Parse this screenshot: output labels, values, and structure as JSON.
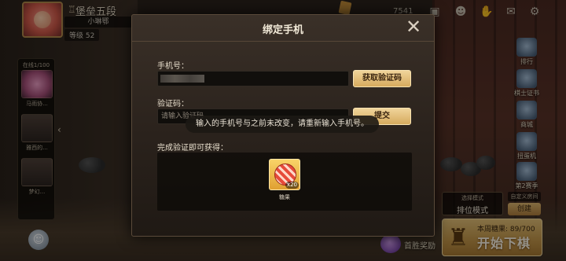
{
  "player": {
    "rank": "堡垒五段",
    "name": "小琳鄂",
    "level": "等级 52"
  },
  "friends": {
    "count": "在线1/100",
    "items": [
      {
        "name": "马雨协..."
      },
      {
        "name": "雅西的..."
      },
      {
        "name": "梦幻..."
      }
    ]
  },
  "topbar": {
    "score": "7541",
    "icons": [
      "photo-icon",
      "friends-icon",
      "thumbs-up-icon",
      "mail-icon",
      "settings-icon"
    ]
  },
  "right_menu": [
    {
      "label": "排行"
    },
    {
      "label": "棋士证书"
    },
    {
      "label": "商城"
    },
    {
      "label": "扭蛋机"
    },
    {
      "label": "第2赛季"
    }
  ],
  "bottom": {
    "mode_small": "选择模式",
    "mode_main": "排位模式",
    "custom_title": "自定义房间",
    "create_label": "创建",
    "week_candy": "本周糖果: 89/700",
    "start_label": "开始下棋",
    "first_win": "首胜奖励"
  },
  "modal": {
    "title": "绑定手机",
    "phone_label": "手机号：",
    "get_code_label": "获取验证码",
    "code_label": "验证码：",
    "code_placeholder": "请输入验证码",
    "submit_label": "提交",
    "reward_label": "完成验证即可获得：",
    "reward": {
      "name": "糖果",
      "count": "x20"
    }
  },
  "toast": "输入的手机号与之前未改变，请重新输入手机号。"
}
